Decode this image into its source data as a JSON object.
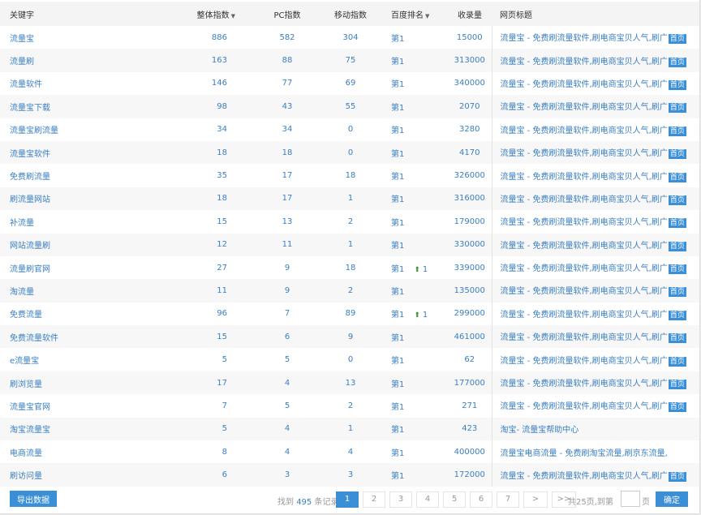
{
  "columns": {
    "keyword": "关键字",
    "overall": "整体指数",
    "pc": "PC指数",
    "mobile": "移动指数",
    "rank": "百度排名",
    "indexed": "收录量",
    "title": "网页标题"
  },
  "rows": [
    {
      "keyword": "流量宝",
      "overall": "886",
      "pc": "582",
      "mobile": "304",
      "rank": "第1",
      "change": "",
      "indexed": "15000",
      "title": "流量宝 - 免费刷流量软件,刷电商宝贝人气,刷广",
      "home": "首页"
    },
    {
      "keyword": "流量刷",
      "overall": "163",
      "pc": "88",
      "mobile": "75",
      "rank": "第1",
      "change": "",
      "indexed": "313000",
      "title": "流量宝 - 免费刷流量软件,刷电商宝贝人气,刷广",
      "home": "首页"
    },
    {
      "keyword": "流量软件",
      "overall": "146",
      "pc": "77",
      "mobile": "69",
      "rank": "第1",
      "change": "",
      "indexed": "340000",
      "title": "流量宝 - 免费刷流量软件,刷电商宝贝人气,刷广",
      "home": "首页"
    },
    {
      "keyword": "流量宝下载",
      "overall": "98",
      "pc": "43",
      "mobile": "55",
      "rank": "第1",
      "change": "",
      "indexed": "2070",
      "title": "流量宝 - 免费刷流量软件,刷电商宝贝人气,刷广",
      "home": "首页"
    },
    {
      "keyword": "流量宝刷流量",
      "overall": "34",
      "pc": "34",
      "mobile": "0",
      "rank": "第1",
      "change": "",
      "indexed": "3280",
      "title": "流量宝 - 免费刷流量软件,刷电商宝贝人气,刷广",
      "home": "首页"
    },
    {
      "keyword": "流量宝软件",
      "overall": "18",
      "pc": "18",
      "mobile": "0",
      "rank": "第1",
      "change": "",
      "indexed": "4170",
      "title": "流量宝 - 免费刷流量软件,刷电商宝贝人气,刷广",
      "home": "首页"
    },
    {
      "keyword": "免费刷流量",
      "overall": "35",
      "pc": "17",
      "mobile": "18",
      "rank": "第1",
      "change": "",
      "indexed": "326000",
      "title": "流量宝 - 免费刷流量软件,刷电商宝贝人气,刷广",
      "home": "首页"
    },
    {
      "keyword": "刷流量网站",
      "overall": "18",
      "pc": "17",
      "mobile": "1",
      "rank": "第1",
      "change": "",
      "indexed": "316000",
      "title": "流量宝 - 免费刷流量软件,刷电商宝贝人气,刷广",
      "home": "首页"
    },
    {
      "keyword": "补流量",
      "overall": "15",
      "pc": "13",
      "mobile": "2",
      "rank": "第1",
      "change": "",
      "indexed": "179000",
      "title": "流量宝 - 免费刷流量软件,刷电商宝贝人气,刷广",
      "home": "首页"
    },
    {
      "keyword": "网站流量刷",
      "overall": "12",
      "pc": "11",
      "mobile": "1",
      "rank": "第1",
      "change": "",
      "indexed": "330000",
      "title": "流量宝 - 免费刷流量软件,刷电商宝贝人气,刷广",
      "home": "首页"
    },
    {
      "keyword": "流量刷官网",
      "overall": "27",
      "pc": "9",
      "mobile": "18",
      "rank": "第1",
      "change": "1",
      "indexed": "339000",
      "title": "流量宝 - 免费刷流量软件,刷电商宝贝人气,刷广",
      "home": "首页"
    },
    {
      "keyword": "淘流量",
      "overall": "11",
      "pc": "9",
      "mobile": "2",
      "rank": "第1",
      "change": "",
      "indexed": "135000",
      "title": "流量宝 - 免费刷流量软件,刷电商宝贝人气,刷广",
      "home": "首页"
    },
    {
      "keyword": "免费流量",
      "overall": "96",
      "pc": "7",
      "mobile": "89",
      "rank": "第1",
      "change": "1",
      "indexed": "299000",
      "title": "流量宝 - 免费刷流量软件,刷电商宝贝人气,刷广",
      "home": "首页"
    },
    {
      "keyword": "免费流量软件",
      "overall": "15",
      "pc": "6",
      "mobile": "9",
      "rank": "第1",
      "change": "",
      "indexed": "461000",
      "title": "流量宝 - 免费刷流量软件,刷电商宝贝人气,刷广",
      "home": "首页"
    },
    {
      "keyword": "e流量宝",
      "overall": "5",
      "pc": "5",
      "mobile": "0",
      "rank": "第1",
      "change": "",
      "indexed": "62",
      "title": "流量宝 - 免费刷流量软件,刷电商宝贝人气,刷广",
      "home": "首页"
    },
    {
      "keyword": "刷浏览量",
      "overall": "17",
      "pc": "4",
      "mobile": "13",
      "rank": "第1",
      "change": "",
      "indexed": "177000",
      "title": "流量宝 - 免费刷流量软件,刷电商宝贝人气,刷广",
      "home": "首页"
    },
    {
      "keyword": "流量宝官网",
      "overall": "7",
      "pc": "5",
      "mobile": "2",
      "rank": "第1",
      "change": "",
      "indexed": "271",
      "title": "流量宝 - 免费刷流量软件,刷电商宝贝人气,刷广",
      "home": "首页"
    },
    {
      "keyword": "淘宝流量宝",
      "overall": "5",
      "pc": "4",
      "mobile": "1",
      "rank": "第1",
      "change": "",
      "indexed": "423",
      "title": "淘宝- 流量宝帮助中心",
      "home": ""
    },
    {
      "keyword": "电商流量",
      "overall": "8",
      "pc": "4",
      "mobile": "4",
      "rank": "第1",
      "change": "",
      "indexed": "400000",
      "title": "流量宝电商流量 - 免费刷淘宝流量,刷京东流量,",
      "home": ""
    },
    {
      "keyword": "刷访问量",
      "overall": "6",
      "pc": "3",
      "mobile": "3",
      "rank": "第1",
      "change": "",
      "indexed": "172000",
      "title": "流量宝 - 免费刷流量软件,刷电商宝贝人气,刷广",
      "home": "首页"
    }
  ],
  "footer": {
    "export_label": "导出数据",
    "found_prefix": "找到",
    "found_count": "495",
    "found_suffix": "条记录",
    "pages": [
      "1",
      "2",
      "3",
      "4",
      "5",
      "6",
      "7",
      ">",
      ">>"
    ],
    "total_text": "共25页,到第",
    "page_word": "页",
    "confirm_label": "确定"
  },
  "colors": {
    "link": "#3a7fc1",
    "accent": "#3a8fd6",
    "up_arrow": "#3a9a2a"
  }
}
